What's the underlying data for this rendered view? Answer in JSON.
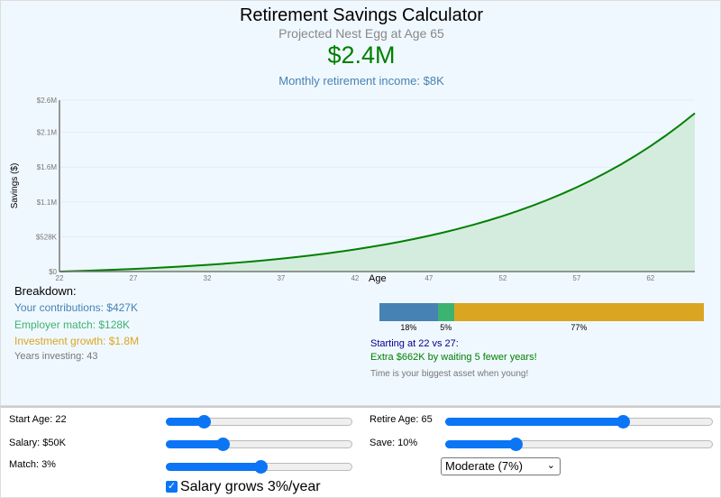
{
  "header": {
    "title": "Retirement Savings Calculator",
    "subtitle": "Projected Nest Egg at Age 65",
    "nest_egg": "$2.4M",
    "monthly": "Monthly retirement income: $8K"
  },
  "chart_data": {
    "type": "area",
    "xlabel": "Age",
    "ylabel": "Savings ($)",
    "xlim": [
      22,
      65
    ],
    "ylim": [
      0,
      2600000
    ],
    "x_ticks": [
      "22",
      "27",
      "32",
      "37",
      "42",
      "47",
      "52",
      "57",
      "62"
    ],
    "y_ticks": [
      {
        "v": 0,
        "label": "$0"
      },
      {
        "v": 528000,
        "label": "$528K"
      },
      {
        "v": 1056000,
        "label": "$1.1M"
      },
      {
        "v": 1584000,
        "label": "$1.6M"
      },
      {
        "v": 2112000,
        "label": "$2.1M"
      },
      {
        "v": 2600000,
        "label": "$2.6M"
      }
    ],
    "grid": true,
    "line_color": "#008000",
    "fill_color": "#d4ecdd",
    "x": [
      22,
      23,
      24,
      25,
      26,
      27,
      28,
      29,
      30,
      31,
      32,
      33,
      34,
      35,
      36,
      37,
      38,
      39,
      40,
      41,
      42,
      43,
      44,
      45,
      46,
      47,
      48,
      49,
      50,
      51,
      52,
      53,
      54,
      55,
      56,
      57,
      58,
      59,
      60,
      61,
      62,
      63,
      64,
      65
    ],
    "y": [
      0,
      6500,
      13650,
      21502,
      30110,
      39534,
      49836,
      61086,
      73356,
      86725,
      101277,
      117101,
      134295,
      152963,
      173215,
      195172,
      218961,
      244718,
      272591,
      302738,
      335328,
      370541,
      408571,
      449626,
      493928,
      541716,
      593245,
      648790,
      708643,
      773119,
      842554,
      917310,
      997772,
      1084353,
      1177498,
      1277680,
      1385408,
      1501225,
      1625714,
      1759500,
      1903250,
      2057681,
      2223558,
      2401701
    ]
  },
  "breakdown": {
    "title": "Breakdown:",
    "contributions": "Your contributions: $427K",
    "match": "Employer match: $128K",
    "growth": "Investment growth: $1.8M",
    "years": "Years investing: 43",
    "bar": [
      {
        "pct": 18,
        "label": "18%",
        "color": "#4682b4"
      },
      {
        "pct": 5,
        "label": "5%",
        "color": "#3cb371"
      },
      {
        "pct": 77,
        "label": "77%",
        "color": "#daa520"
      }
    ],
    "compare": "Starting at 22 vs 27:",
    "extra": "Extra $662K by waiting 5 fewer years!",
    "tip": "Time is your biggest asset when young!"
  },
  "controls": {
    "start_age": {
      "label": "Start Age: 22",
      "level": 0.2
    },
    "salary": {
      "label": "Salary: $50K",
      "level": 0.3
    },
    "match": {
      "label": "Match: 3%",
      "level": 0.5
    },
    "retire_age": {
      "label": "Retire Age: 65",
      "level": 0.66
    },
    "save": {
      "label": "Save: 10%",
      "level": 0.26
    },
    "return_select": "Moderate (7%)",
    "salary_growth": {
      "label": "Salary grows 3%/year",
      "checked": true
    }
  }
}
